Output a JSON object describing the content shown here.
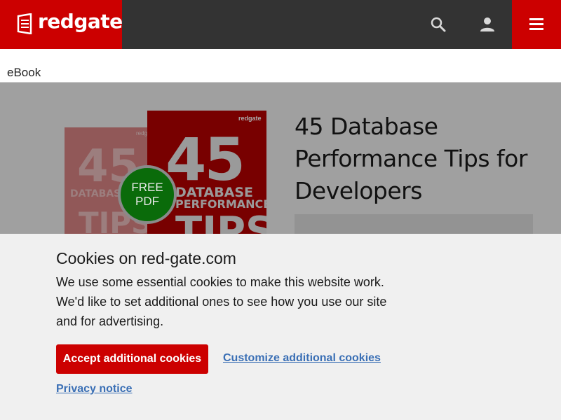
{
  "header": {
    "logo_text": "redgate",
    "brand_color": "#cc0000",
    "bar_color": "#333333",
    "icons": [
      "search-icon",
      "user-icon",
      "menu-icon"
    ]
  },
  "breadcrumb": {
    "label": "eBook"
  },
  "hero": {
    "title": "45 Database Performance Tips for Developers",
    "badge_line1": "FREE",
    "badge_line2": "PDF",
    "badge_color": "#0a6b0a",
    "book": {
      "logo": "redgate",
      "number": "45",
      "line1": "DATABASE",
      "line2": "PERFORMANCE",
      "line3": "TIPS"
    }
  },
  "cookie_banner": {
    "title": "Cookies on red-gate.com",
    "body": "We use some essential cookies to make this website work. We'd like to set additional ones to see how you use our site and for advertising.",
    "accept_label": "Accept additional cookies",
    "customize_label": "Customize additional cookies",
    "privacy_label": "Privacy notice",
    "link_color": "#3a6fb5"
  }
}
